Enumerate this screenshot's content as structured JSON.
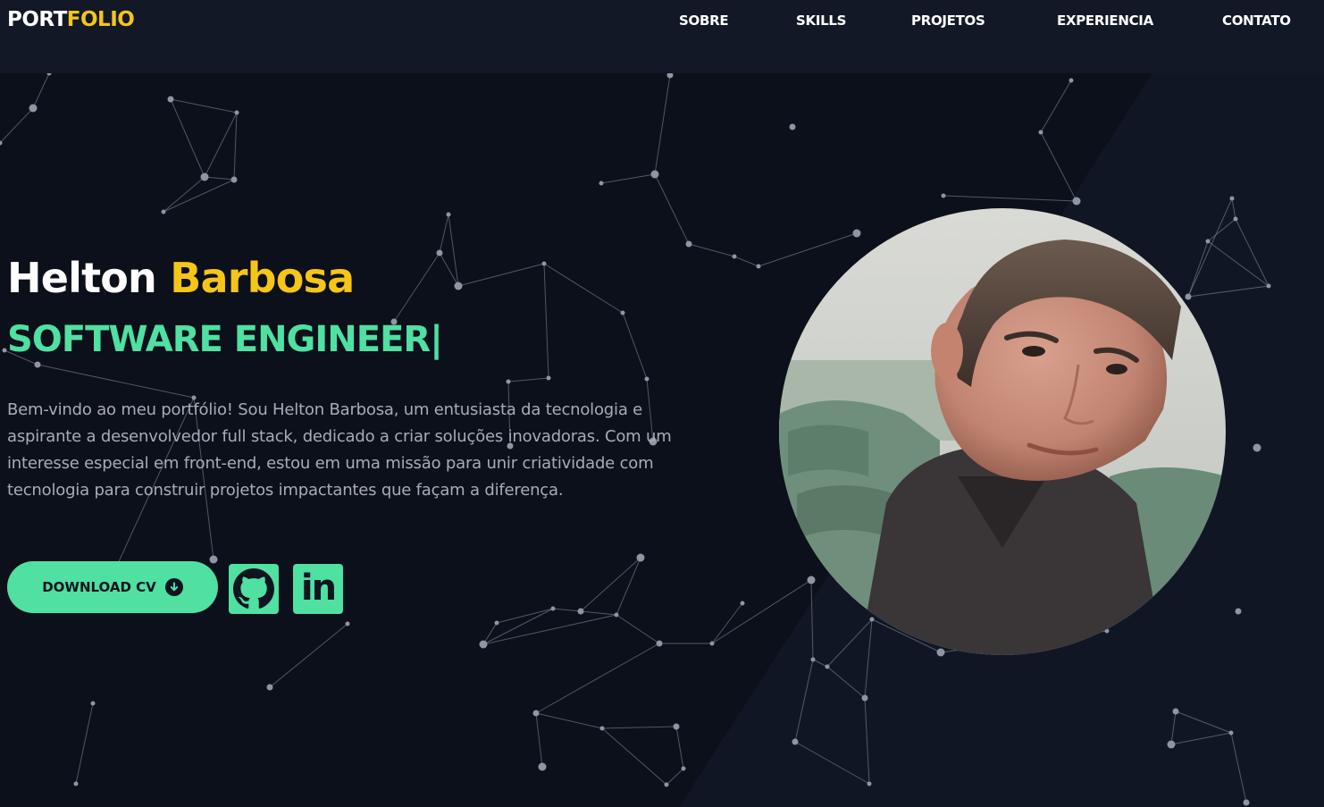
{
  "header": {
    "logo_part1": "PORT",
    "logo_part2": "FOLIO",
    "nav": [
      "SOBRE",
      "SKILLS",
      "PROJETOS",
      "EXPERIENCIA",
      "CONTATO"
    ]
  },
  "hero": {
    "first_name": "Helton",
    "last_name": "Barbosa",
    "role": "SOFTWARE ENGINEER",
    "caret": "|",
    "bio": "Bem-vindo ao meu portfólio! Sou Helton Barbosa, um entusiasta da tecnologia e aspirante a desenvolvedor full stack, dedicado a criar soluções inovadoras. Com um interesse especial em front-end, estou em uma missão para unir criatividade com tecnologia para construir projetos impactantes que façam a diferença.",
    "download_label": "DOWNLOAD CV",
    "linkedin_glyph": "in",
    "avatar_alt": "Helton Barbosa"
  },
  "colors": {
    "background": "#0b101a",
    "header": "#121826",
    "accent_green": "#4fe0a2",
    "accent_yellow": "#f5c518",
    "text_muted": "#a7adb8"
  },
  "icons": {
    "download": "arrow-down-circle-icon",
    "github": "github-icon",
    "linkedin": "linkedin-icon"
  }
}
